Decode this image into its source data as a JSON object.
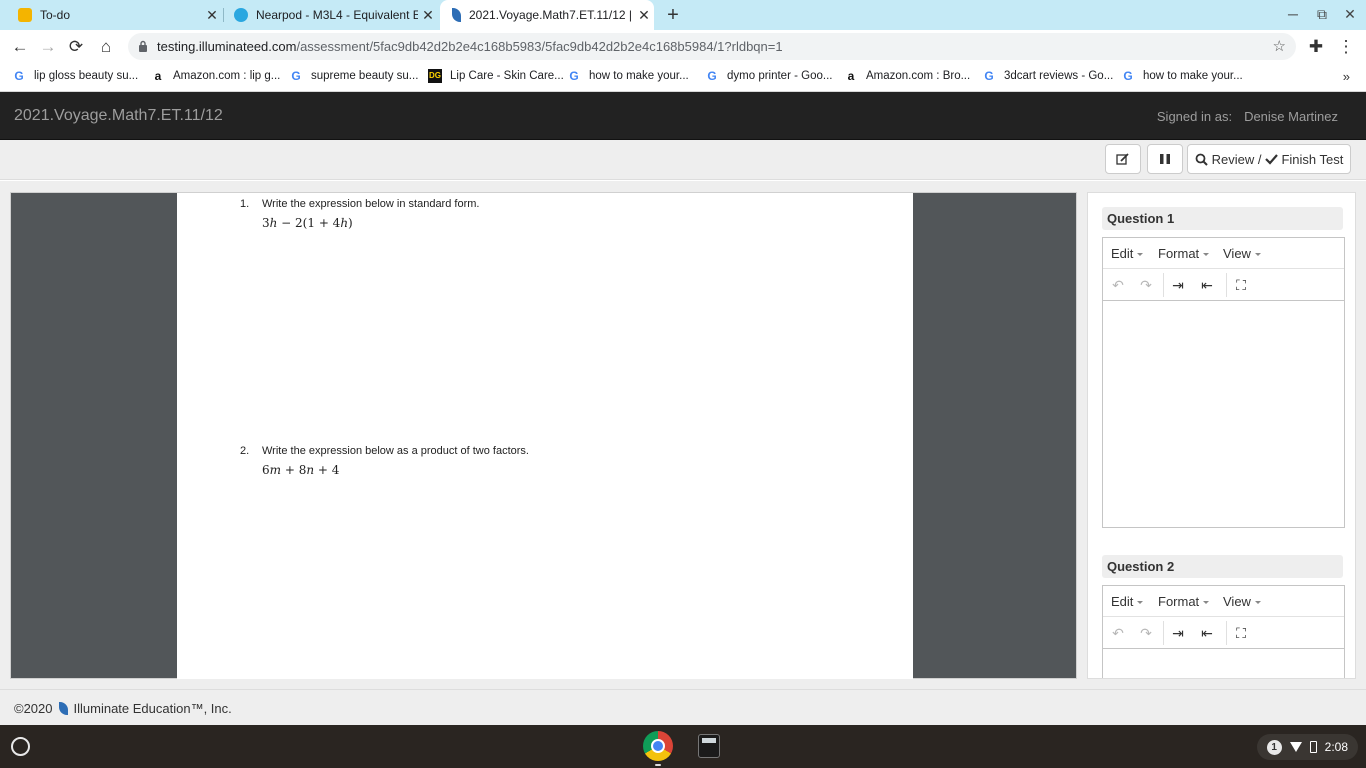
{
  "browser": {
    "tabs": [
      {
        "title": "To-do",
        "icon": "todo-icon",
        "color": "#f4b400",
        "active": false
      },
      {
        "title": "Nearpod - M3L4 - Equivalent Exp",
        "icon": "nearpod-icon",
        "color": "#2aa7e0",
        "active": false
      },
      {
        "title": "2021.Voyage.Math7.ET.11/12 | I",
        "icon": "illuminate-icon",
        "color": "#2d6db5",
        "active": true
      }
    ],
    "url_host": "testing.illuminateed.com",
    "url_path": "/assessment/5fac9db42d2b2e4c168b5983/5fac9db42d2b2e4c168b5984/1?rldbqn=1",
    "bookmarks": [
      {
        "label": "lip gloss beauty su...",
        "icon": "google-icon"
      },
      {
        "label": "Amazon.com : lip g...",
        "icon": "amazon-icon"
      },
      {
        "label": "supreme beauty su...",
        "icon": "google-icon"
      },
      {
        "label": "Lip Care - Skin Care...",
        "icon": "dollar-general-icon"
      },
      {
        "label": "how to make your...",
        "icon": "google-icon"
      },
      {
        "label": "dymo printer - Goo...",
        "icon": "google-icon"
      },
      {
        "label": "Amazon.com : Bro...",
        "icon": "amazon-icon"
      },
      {
        "label": "3dcart reviews - Go...",
        "icon": "google-icon"
      },
      {
        "label": "how to make your...",
        "icon": "google-icon"
      }
    ]
  },
  "app": {
    "title": "2021.Voyage.Math7.ET.11/12",
    "signed_label": "Signed in as:",
    "user": "Denise Martinez"
  },
  "toolbar": {
    "review_label": "Review /",
    "finish_label": "Finish Test"
  },
  "questions": [
    {
      "num": "1.",
      "text": "Write the expression below in standard form.",
      "expr": "3ℎ − 2(1 + 4ℎ)"
    },
    {
      "num": "2.",
      "text": "Write the expression below as a product of two factors.",
      "expr": "6𝑚 + 8𝑛 + 4"
    }
  ],
  "answer_panel": {
    "q1_title": "Question 1",
    "q2_title": "Question 2",
    "menus": [
      "Edit",
      "Format",
      "View"
    ]
  },
  "footer": {
    "copyright": "©2020",
    "company": "Illuminate Education™, Inc."
  },
  "shelf": {
    "notif_count": "1",
    "time": "2:08"
  }
}
